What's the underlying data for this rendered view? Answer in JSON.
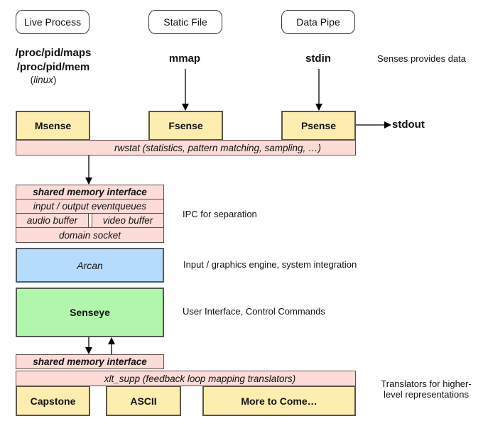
{
  "sources": {
    "live_process": "Live Process",
    "static_file": "Static File",
    "data_pipe": "Data Pipe"
  },
  "access": {
    "proc_maps": "/proc/pid/maps",
    "proc_mem": "/proc/pid/mem",
    "linux_open": "(",
    "linux": "linux",
    "linux_close": ")",
    "mmap": "mmap",
    "stdin": "stdin",
    "stdout": "stdout"
  },
  "senses": {
    "msense": "Msense",
    "fsense": "Fsense",
    "psense": "Psense",
    "rwstat": "rwstat (statistics, pattern matching, sampling, …)"
  },
  "ipc": {
    "shmif": "shared memory interface",
    "eventqueues": "input / output eventqueues",
    "audio": "audio buffer",
    "video": "video buffer",
    "socket": "domain socket"
  },
  "engine": {
    "arcan": "Arcan"
  },
  "ui": {
    "senseye": "Senseye"
  },
  "translators": {
    "shmif": "shared memory interface",
    "xlt_supp": "xlt_supp (feedback loop mapping translators)",
    "capstone": "Capstone",
    "ascii": "ASCII",
    "more": "More to Come…"
  },
  "notes": {
    "senses": "Senses provides data",
    "ipc": "IPC for separation",
    "engine": "Input / graphics engine, system integration",
    "ui": "User Interface, Control Commands",
    "translators_line1": "Translators for higher-",
    "translators_line2": "level representations"
  },
  "colors": {
    "sense_fill": "#fdeeb0",
    "ipc_fill": "#fddcd8",
    "engine_fill": "#b6dcfd",
    "ui_fill": "#b0f7ac"
  }
}
